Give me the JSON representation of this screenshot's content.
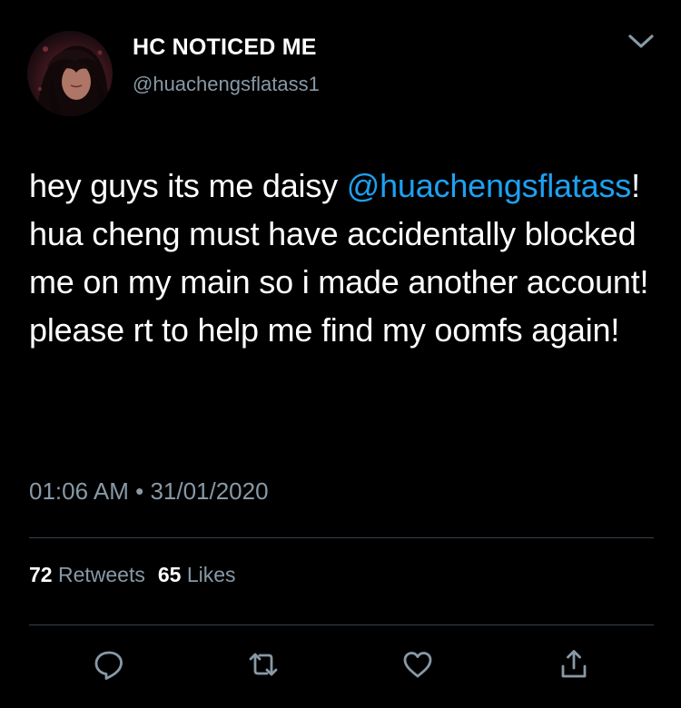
{
  "author": {
    "display_name": "HC NOTICED ME",
    "handle": "@huachengsflatass1"
  },
  "tweet": {
    "text_before_mention": "hey guys its me daisy ",
    "mention": "@huachengsflatass",
    "text_after_mention": "! hua cheng must have accidentally blocked me on my main so i made another account! please rt to help me find my oomfs again!",
    "time": "01:06 AM",
    "separator": "•",
    "date": "31/01/2020"
  },
  "stats": {
    "retweets_count": "72",
    "retweets_label": "Retweets",
    "likes_count": "65",
    "likes_label": "Likes"
  },
  "icons": {
    "menu": "chevron-down-icon",
    "reply": "reply-icon",
    "retweet": "retweet-icon",
    "like": "heart-icon",
    "share": "share-icon"
  },
  "colors": {
    "background": "#000000",
    "text": "#ffffff",
    "secondary_text": "#8899a6",
    "link": "#1da1f2",
    "divider": "#38444d"
  }
}
